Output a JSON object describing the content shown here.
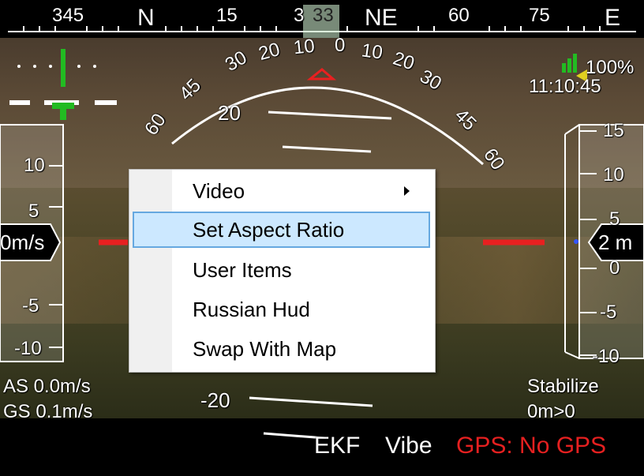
{
  "heading_tape": {
    "labels": [
      "345",
      "N",
      "15",
      "3",
      "33",
      "NE",
      "60",
      "75",
      "E"
    ]
  },
  "attitude": {
    "roll_labels": [
      "60",
      "45",
      "30",
      "20",
      "10",
      "0",
      "10",
      "20",
      "30",
      "45",
      "60"
    ],
    "pitch_labels": [
      "20",
      "-20"
    ]
  },
  "speed_tape": {
    "labels": [
      "10",
      "5",
      "0",
      "-5",
      "-10"
    ],
    "readout": "0m/s"
  },
  "altitude_tape": {
    "labels": [
      "15",
      "10",
      "5",
      "0",
      "-5",
      "-10"
    ],
    "readout": "2 m"
  },
  "status": {
    "battery": "100%",
    "time": "11:10:45",
    "airspeed": "AS 0.0m/s",
    "groundspeed": "GS 0.1m/s",
    "mode": "Stabilize",
    "distance": "0m>0",
    "ekf": "EKF",
    "vibe": "Vibe",
    "gps": "GPS: No GPS"
  },
  "context_menu": {
    "items": [
      {
        "label": "Video",
        "has_submenu": true
      },
      {
        "label": "Set Aspect Ratio",
        "highlighted": true
      },
      {
        "label": "User Items"
      },
      {
        "label": "Russian Hud"
      },
      {
        "label": "Swap With Map"
      }
    ]
  },
  "colors": {
    "gps_error": "#e52020",
    "highlight": "#cce8ff",
    "highlight_border": "#66a8e0",
    "target_marker": "#e82020",
    "level_green": "#22bb22"
  }
}
